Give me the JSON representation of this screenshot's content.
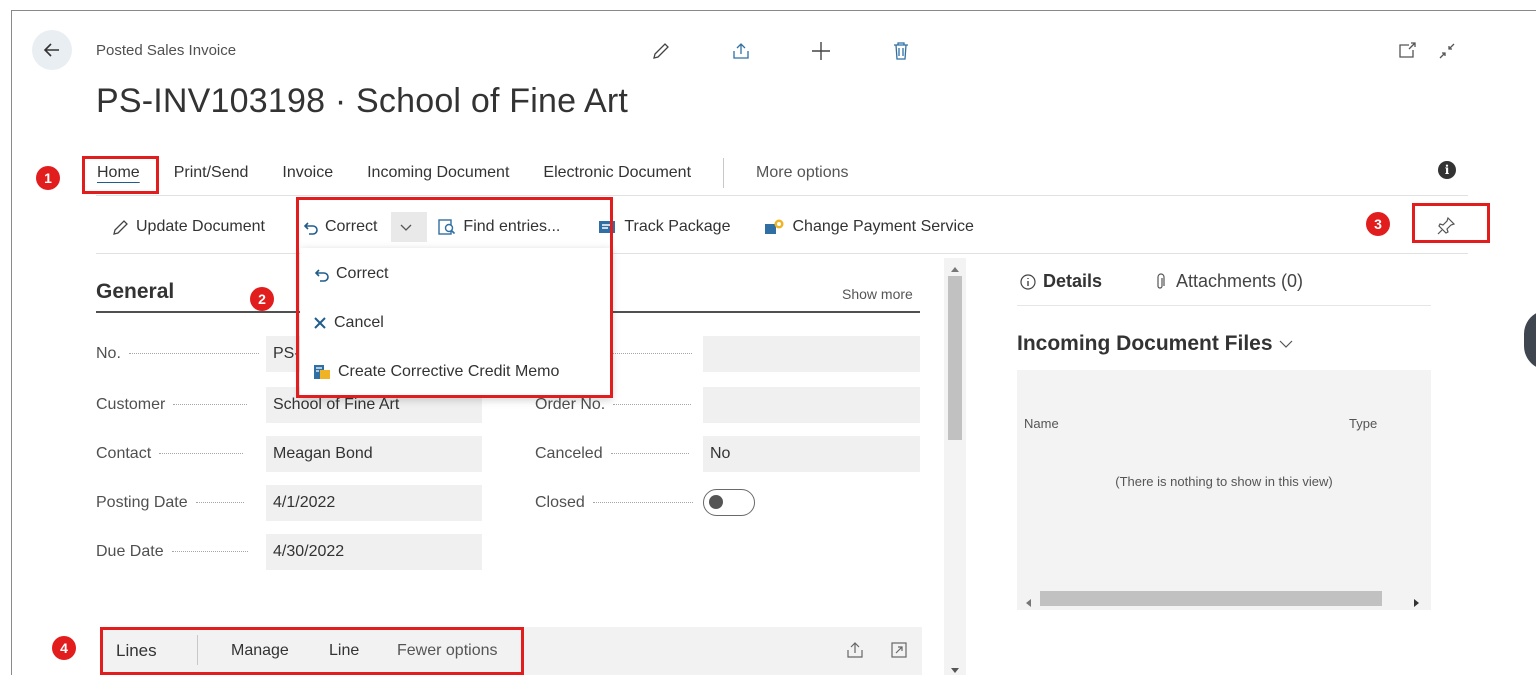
{
  "header": {
    "caption": "Posted Sales Invoice",
    "title": "PS-INV103198 · School of Fine Art",
    "icons": [
      "edit-icon",
      "share-icon",
      "add-icon",
      "delete-icon",
      "open-new-window-icon",
      "collapse-icon"
    ]
  },
  "tabs": {
    "home": "Home",
    "print_send": "Print/Send",
    "invoice": "Invoice",
    "incoming_document": "Incoming Document",
    "electronic_document": "Electronic Document",
    "more_options": "More options"
  },
  "actions": {
    "update_document": "Update Document",
    "correct": "Correct",
    "find_entries": "Find entries...",
    "track_package": "Track Package",
    "change_payment_service": "Change Payment Service"
  },
  "correct_menu": {
    "correct": "Correct",
    "cancel": "Cancel",
    "create_corrective_credit_memo": "Create Corrective Credit Memo"
  },
  "annotations": {
    "b1": "1",
    "b2": "2",
    "b3": "3",
    "b4": "4"
  },
  "general": {
    "title": "General",
    "show_more": "Show more",
    "fields_left": [
      {
        "label": "No.",
        "value": "PS-"
      },
      {
        "label": "Customer",
        "value": "School of Fine Art"
      },
      {
        "label": "Contact",
        "value": "Meagan Bond"
      },
      {
        "label": "Posting Date",
        "value": "4/1/2022"
      },
      {
        "label": "Due Date",
        "value": "4/30/2022"
      }
    ],
    "fields_right": [
      {
        "label": "Order No.",
        "value": ""
      },
      {
        "label": "Canceled",
        "value": "No"
      },
      {
        "label": "Closed",
        "value": ""
      }
    ],
    "closed_toggle": false
  },
  "factbox": {
    "tab_details": "Details",
    "tab_attachments": "Attachments (0)",
    "title": "Incoming Document Files",
    "col_name": "Name",
    "col_type": "Type",
    "empty": "(There is nothing to show in this view)"
  },
  "lines": {
    "title": "Lines",
    "manage": "Manage",
    "line": "Line",
    "fewer_options": "Fewer options"
  },
  "colors": {
    "accent": "#1f5d8c",
    "annotation": "#e11d1d"
  }
}
